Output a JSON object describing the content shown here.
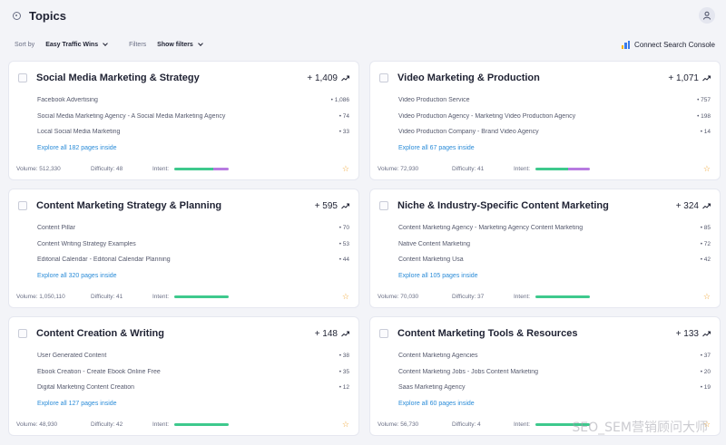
{
  "header": {
    "title": "Topics"
  },
  "toolbar": {
    "sort_label": "Sort by",
    "sort_value": "Easy Traffic Wins",
    "filters_label": "Filters",
    "filters_value": "Show filters",
    "gsc_label": "Connect Search Console"
  },
  "colors": {
    "intent_green": "#3ec98d",
    "intent_purple": "#b77be0",
    "link": "#2b8cd8",
    "star": "#f0a73a"
  },
  "cards": [
    {
      "title": "Social Media Marketing & Strategy",
      "growth": "+ 1,409",
      "keywords": [
        {
          "name": "Facebook Advertising",
          "value": "• 1,086"
        },
        {
          "name": "Social Media Marketing Agency - A Social Media Marketing Agency",
          "value": "• 74"
        },
        {
          "name": "Local Social Media Marketing",
          "value": "• 33"
        }
      ],
      "explore": "Explore all 182 pages inside",
      "volume": "Volume: 512,330",
      "difficulty": "Difficulty: 48",
      "intent_label": "Intent:",
      "intent": {
        "green": 0.72,
        "purple": 0.28
      }
    },
    {
      "title": "Video Marketing & Production",
      "growth": "+ 1,071",
      "keywords": [
        {
          "name": "Video Production Service",
          "value": "• 757"
        },
        {
          "name": "Video Production Agency - Marketing Video Production Agency",
          "value": "• 198"
        },
        {
          "name": "Video Production Company - Brand Video Agency",
          "value": "• 14"
        }
      ],
      "explore": "Explore all 67 pages inside",
      "volume": "Volume: 72,930",
      "difficulty": "Difficulty: 41",
      "intent_label": "Intent:",
      "intent": {
        "green": 0.6,
        "purple": 0.4
      }
    },
    {
      "title": "Content Marketing Strategy & Planning",
      "growth": "+ 595",
      "keywords": [
        {
          "name": "Content Pillar",
          "value": "• 70"
        },
        {
          "name": "Content Writing Strategy Examples",
          "value": "• 53"
        },
        {
          "name": "Editorial Calendar - Editorial Calendar Planning",
          "value": "• 44"
        }
      ],
      "explore": "Explore all 320 pages inside",
      "volume": "Volume: 1,050,110",
      "difficulty": "Difficulty: 41",
      "intent_label": "Intent:",
      "intent": {
        "green": 1.0,
        "purple": 0
      }
    },
    {
      "title": "Niche & Industry-Specific Content Marketing",
      "growth": "+ 324",
      "keywords": [
        {
          "name": "Content Marketing Agency - Marketing Agency Content Marketing",
          "value": "• 85"
        },
        {
          "name": "Native Content Marketing",
          "value": "• 72"
        },
        {
          "name": "Content Marketing Usa",
          "value": "• 42"
        }
      ],
      "explore": "Explore all 105 pages inside",
      "volume": "Volume: 70,030",
      "difficulty": "Difficulty: 37",
      "intent_label": "Intent:",
      "intent": {
        "green": 1.0,
        "purple": 0
      }
    },
    {
      "title": "Content Creation & Writing",
      "growth": "+ 148",
      "keywords": [
        {
          "name": "User Generated Content",
          "value": "• 38"
        },
        {
          "name": "Ebook Creation - Create Ebook Online Free",
          "value": "• 35"
        },
        {
          "name": "Digital Marketing Content Creation",
          "value": "• 12"
        }
      ],
      "explore": "Explore all 127 pages inside",
      "volume": "Volume: 48,930",
      "difficulty": "Difficulty: 42",
      "intent_label": "Intent:",
      "intent": {
        "green": 1.0,
        "purple": 0
      }
    },
    {
      "title": "Content Marketing Tools & Resources",
      "growth": "+ 133",
      "keywords": [
        {
          "name": "Content Marketing Agencies",
          "value": "• 37"
        },
        {
          "name": "Content Marketing Jobs - Jobs Content Marketing",
          "value": "• 20"
        },
        {
          "name": "Saas Marketing Agency",
          "value": "• 19"
        }
      ],
      "explore": "Explore all 60 pages inside",
      "volume": "Volume: 56,730",
      "difficulty": "Difficulty: 4",
      "intent_label": "Intent:",
      "intent": {
        "green": 1.0,
        "purple": 0
      }
    }
  ],
  "watermark": "SEO_SEM营销顾问大师"
}
